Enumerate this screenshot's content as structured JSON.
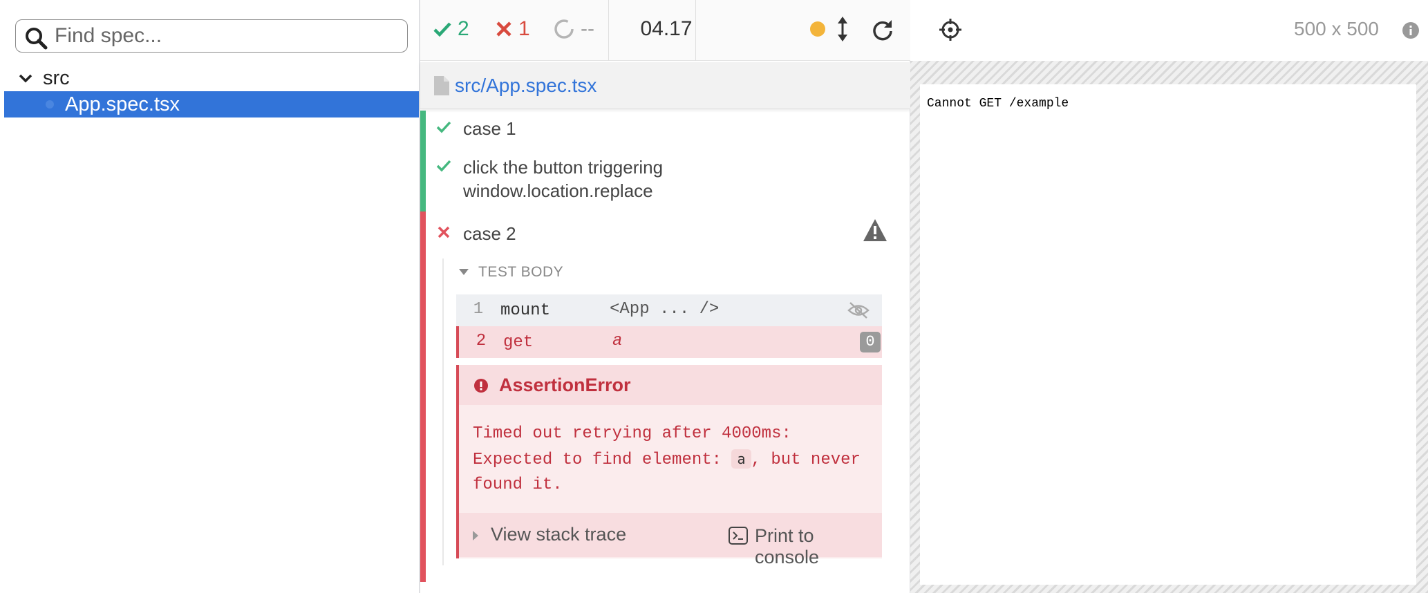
{
  "spec_list": {
    "search_placeholder": "Find spec...",
    "folder": "src",
    "file": "App.spec.tsx"
  },
  "stats": {
    "passed": "2",
    "failed": "1",
    "pending": "--",
    "duration": "04.17"
  },
  "spec_header": {
    "path": "src/App.spec.tsx"
  },
  "tests": [
    {
      "title": "case 1",
      "state": "passed"
    },
    {
      "title_line1": "click the button triggering",
      "title_line2": "window.location.replace",
      "state": "passed"
    },
    {
      "title": "case 2",
      "state": "failed"
    }
  ],
  "test_body": {
    "label": "TEST BODY",
    "commands": [
      {
        "num": "1",
        "name": "mount",
        "message": "<App ... />"
      },
      {
        "num": "2",
        "name": "get",
        "message": "a",
        "count": "0"
      }
    ]
  },
  "error": {
    "name": "AssertionError",
    "message_line1": "Timed out retrying after 4000ms:",
    "message_pre": "Expected to find element: ",
    "message_code": "a",
    "message_post": ", but never",
    "message_line3": "found it.",
    "stack_link": "View stack trace",
    "console_link": "Print to console"
  },
  "aut": {
    "viewport": "500 x 500",
    "content": "Cannot GET /example"
  },
  "colors": {
    "accent": "#3274d9",
    "pass": "#45b87f",
    "fail": "#e1525d",
    "running": "#f3b43a"
  }
}
